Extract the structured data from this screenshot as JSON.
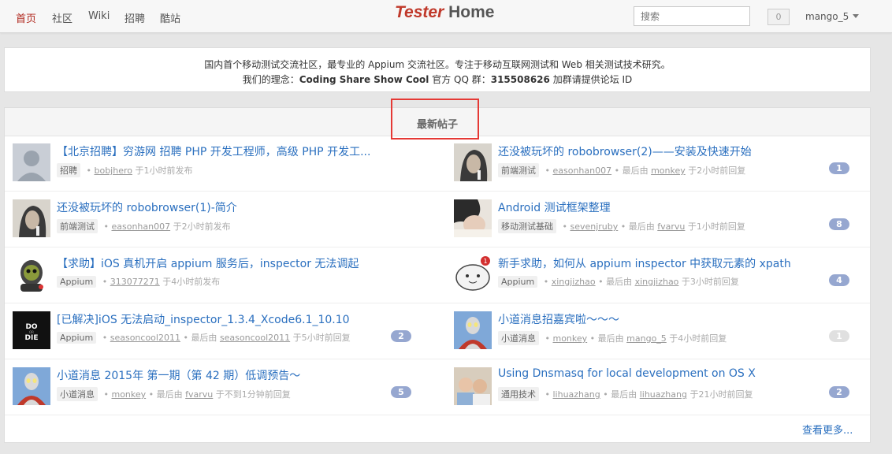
{
  "nav": {
    "items": [
      "首页",
      "社区",
      "Wiki",
      "招聘",
      "酷站"
    ],
    "brand_a": "Tester",
    "brand_b": "Home",
    "search_placeholder": "搜索",
    "notifications": "0",
    "user": "mango_5"
  },
  "intro": {
    "line1": "国内首个移动测试交流社区，最专业的 Appium 交流社区。专注于移动互联网测试和 Web 相关测试技术研究。",
    "line2_prefix": "我们的理念：",
    "line2_bold": "Coding Share Show Cool",
    "line2_mid": " 官方 QQ 群：",
    "line2_qq": "315508626",
    "line2_suffix": " 加群请提供论坛 ID"
  },
  "panel": {
    "title": "最新帖子",
    "more": "查看更多..."
  },
  "colors": {
    "accent": "#b0271d",
    "link": "#2a6fbf",
    "badge": "#96a7d0",
    "highlight": "#e53935"
  },
  "topics": [
    {
      "title": "【北京招聘】穷游网 招聘 PHP 开发工程师，高级 PHP 开发工...",
      "node": "招聘",
      "user": "bobjhero",
      "last_prefix": "",
      "last_user": "",
      "time": "于1小时前发布",
      "replies": "",
      "avatar": "default-avatar-icon"
    },
    {
      "title": "还没被玩坏的 robobrowser(2)——安装及快速开始",
      "node": "前端测试",
      "user": "easonhan007",
      "last_prefix": "最后由",
      "last_user": "monkey",
      "time": "于2小时前回复",
      "replies": "1",
      "avatar": "portrait-avatar"
    },
    {
      "title": "还没被玩坏的 robobrowser(1)-简介",
      "node": "前端测试",
      "user": "easonhan007",
      "last_prefix": "",
      "last_user": "",
      "time": "于2小时前发布",
      "replies": "",
      "avatar": "portrait-avatar"
    },
    {
      "title": "Android 测试框架整理",
      "node": "移动测试基础",
      "user": "sevenjruby",
      "last_prefix": "最后由",
      "last_user": "fvarvu",
      "time": "于1小时前回复",
      "replies": "8",
      "avatar": "photo-avatar"
    },
    {
      "title": "【求助】iOS 真机开启 appium 服务后，inspector 无法调起",
      "node": "Appium",
      "user": "313077271",
      "last_prefix": "",
      "last_user": "",
      "time": "于4小时前发布",
      "replies": "",
      "avatar": "robot-avatar"
    },
    {
      "title": "新手求助，如何从 appium inspector 中获取元素的 xpath",
      "node": "Appium",
      "user": "xingjizhao",
      "last_prefix": "最后由",
      "last_user": "xingjizhao",
      "time": "于3小时前回复",
      "replies": "4",
      "avatar": "cartoon-avatar"
    },
    {
      "title": "[已解决]iOS 无法启动_inspector_1.3.4_Xcode6.1_10.10",
      "node": "Appium",
      "user": "seasoncool2011",
      "last_prefix": "最后由",
      "last_user": "seasoncool2011",
      "time": "于5小时前回复",
      "replies": "2",
      "avatar": "dark-avatar"
    },
    {
      "title": "小道消息招嘉宾啦～～～",
      "node": "小道消息",
      "user": "monkey",
      "last_prefix": "最后由",
      "last_user": "mango_5",
      "time": "于4小时前回复",
      "replies": "1",
      "avatar": "hero-avatar"
    },
    {
      "title": "小道消息 2015年 第一期（第 42 期）低调预告～",
      "node": "小道消息",
      "user": "monkey",
      "last_prefix": "最后由",
      "last_user": "fvarvu",
      "time": "于不到1分钟前回复",
      "replies": "5",
      "avatar": "hero-avatar"
    },
    {
      "title": "Using Dnsmasq for local development on OS X",
      "node": "通用技术",
      "user": "lihuazhang",
      "last_prefix": "最后由",
      "last_user": "lihuazhang",
      "time": "于21小时前回复",
      "replies": "2",
      "avatar": "kids-avatar"
    }
  ]
}
